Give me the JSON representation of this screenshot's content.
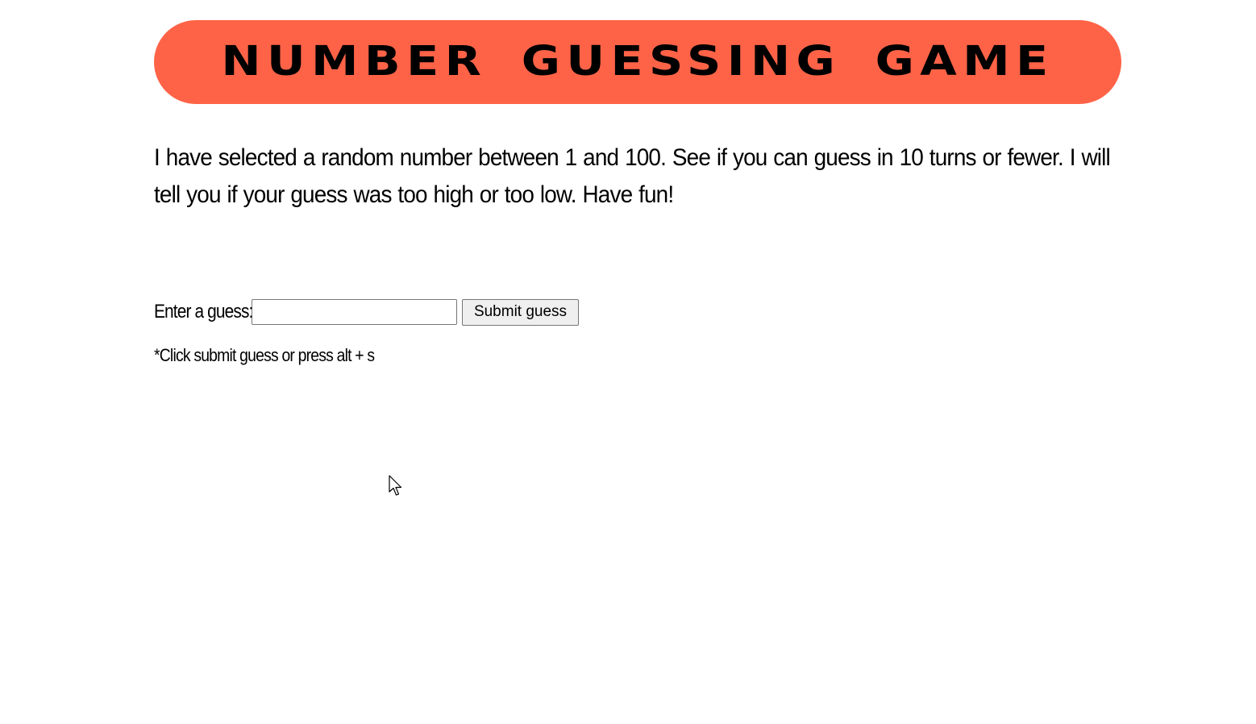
{
  "header": {
    "title": "NUMBER GUESSING GAME",
    "banner_color": "#ff6347"
  },
  "main": {
    "intro_text": "I have selected a random number between 1 and 100. See if you can guess in 10 turns or fewer. I will tell you if your guess was too high or too low. Have fun!"
  },
  "form": {
    "guess_label": "Enter a guess:",
    "guess_value": "",
    "submit_label": "Submit guess",
    "hint_text": "*Click submit guess or press alt + s"
  },
  "icons": {
    "cursor": "mouse-pointer-icon"
  }
}
